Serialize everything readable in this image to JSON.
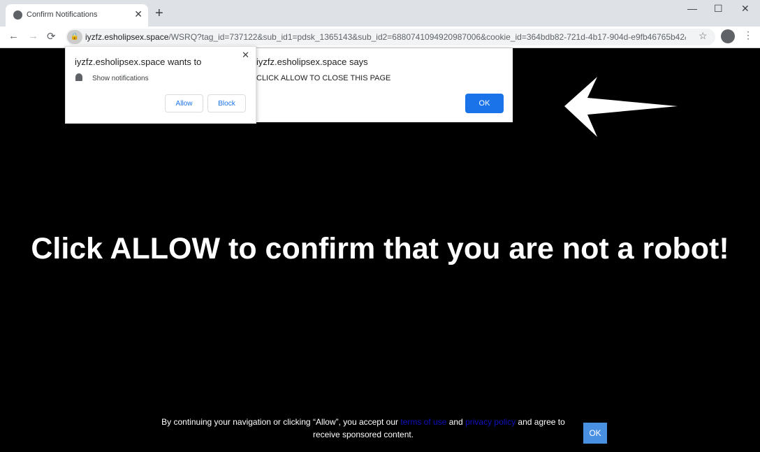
{
  "browser": {
    "tab_title": "Confirm Notifications",
    "tab_close": "✕",
    "new_tab": "+",
    "window_controls": {
      "minimize": "—",
      "maximize": "☐",
      "close": "✕"
    },
    "nav": {
      "back": "←",
      "forward": "→",
      "reload": "⟳"
    },
    "url_host": "iyzfz.esholipsex.space",
    "url_rest": "/WSRQ?tag_id=737122&sub_id1=pdsk_1365143&sub_id2=6880741094920987006&cookie_id=364bdb82-721d-4b17-904d-e9fb46765b42&l...",
    "star": "☆",
    "menu": "⋮"
  },
  "permission_prompt": {
    "title": "iyzfz.esholipsex.space wants to",
    "item": "Show notifications",
    "allow": "Allow",
    "block": "Block",
    "close": "✕"
  },
  "alert": {
    "title": "iyzfz.esholipsex.space says",
    "message": "CLICK ALLOW TO CLOSE THIS PAGE",
    "ok": "OK"
  },
  "page": {
    "headline": "Click ALLOW to confirm that you are not a robot!",
    "footer_pre": "By continuing your navigation or clicking “Allow”, you accept our ",
    "terms": "terms of use",
    "and": " and ",
    "privacy": "privacy policy",
    "footer_post": " and agree to receive sponsored content.",
    "ok": "OK"
  }
}
